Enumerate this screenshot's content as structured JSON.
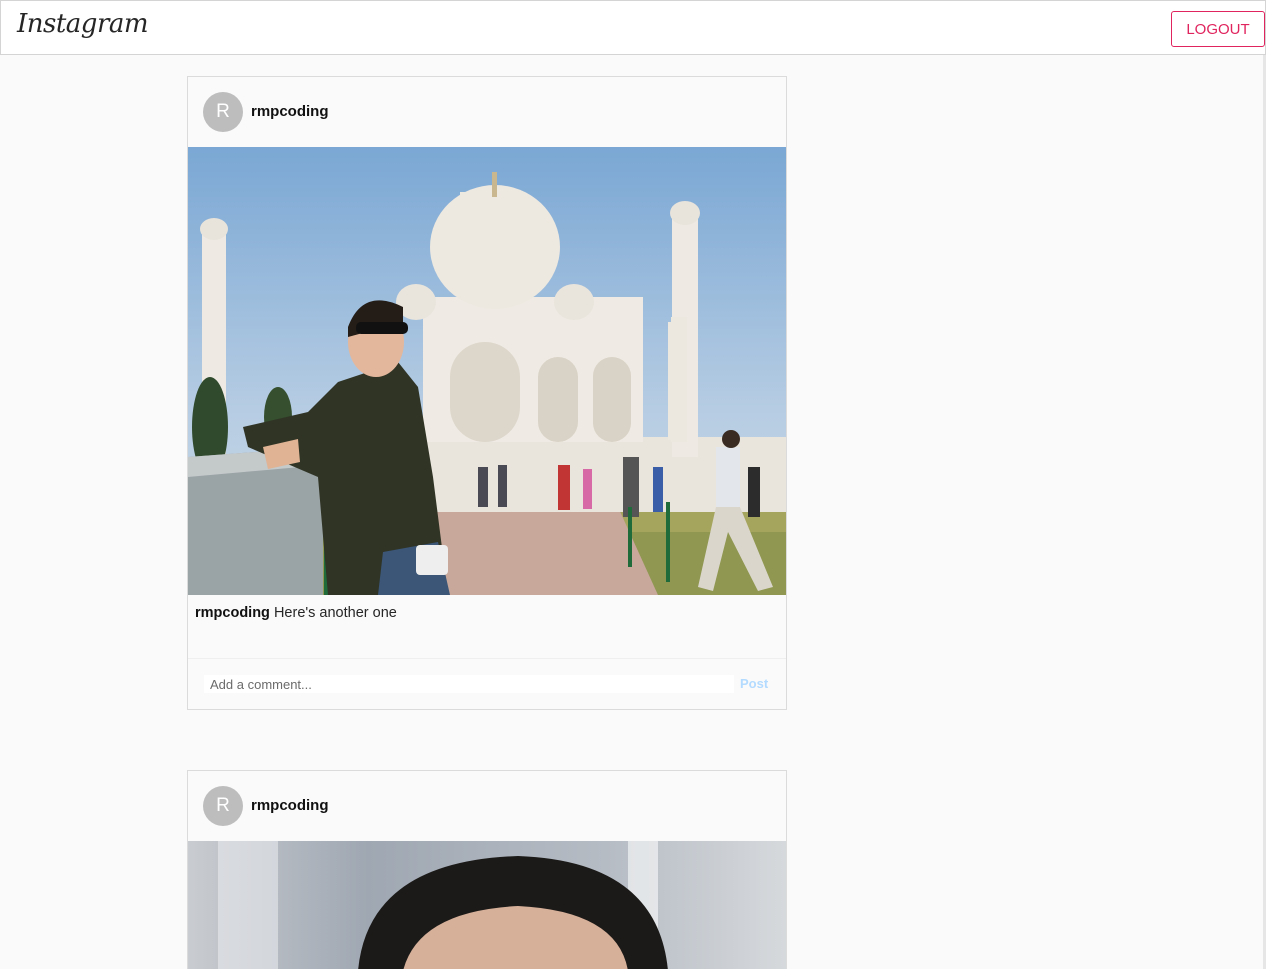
{
  "header": {
    "logo_text": "Instagram",
    "logout_label": "LOGOUT"
  },
  "posts": [
    {
      "avatar_letter": "R",
      "username": "rmpcoding",
      "image_alt": "",
      "caption_user": "rmpcoding",
      "caption_text": "Here's another one",
      "comment_placeholder": "Add a comment...",
      "post_label": "Post"
    },
    {
      "avatar_letter": "R",
      "username": "rmpcoding",
      "image_alt": ""
    }
  ],
  "colors": {
    "accent": "#e0245e",
    "post_button_disabled": "#b3dbff",
    "avatar_bg": "#bdbdbd"
  }
}
